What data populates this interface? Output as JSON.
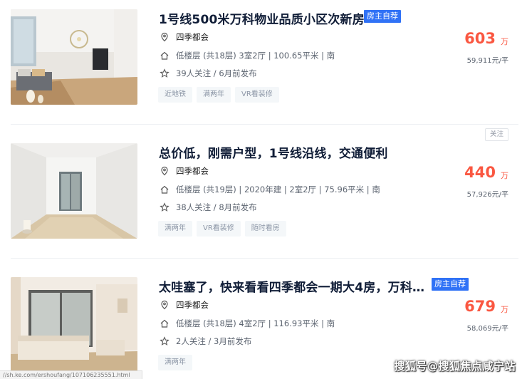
{
  "listings": [
    {
      "title": "1号线500米万科物业品质小区次新房",
      "badge": "房主自荐",
      "community": "四季都会",
      "details": "低楼层 (共18层) 3室2厅 | 100.65平米 | 南",
      "stats": "39人关注 / 6月前发布",
      "tags": [
        "近地铁",
        "满两年",
        "VR看装修"
      ],
      "price": "603",
      "price_unit": "万",
      "unit_price": "59,911元/平"
    },
    {
      "title": "总价低，刚需户型，1号线沿线，交通便利",
      "follow_label": "关注",
      "community": "四季都会",
      "details": "低楼层 (共19层) | 2020年建 | 2室2厅 | 75.96平米 | 南",
      "stats": "38人关注 / 8月前发布",
      "tags": [
        "满两年",
        "VR看装修",
        "随时看房"
      ],
      "price": "440",
      "price_unit": "万",
      "unit_price": "57,926元/平"
    },
    {
      "title": "太哇塞了，快来看看四季都会一期大4房，万科…",
      "badge": "房主自荐",
      "community": "四季都会",
      "details": "低楼层 (共18层) 4室2厅 | 116.93平米 | 南",
      "stats": "2人关注 / 3月前发布",
      "tags": [
        "满两年"
      ],
      "price": "679",
      "price_unit": "万",
      "unit_price": "58,069元/平"
    }
  ],
  "status_url": "//sh.ke.com/ershoufang/107106235551.html",
  "watermark": "搜狐号@搜狐焦点咸宁站",
  "icons": {
    "location": "location-pin-icon",
    "house": "house-icon",
    "star": "star-icon"
  },
  "colors": {
    "price": "#fa5741",
    "badge": "#3072f6",
    "title": "#101d37"
  }
}
